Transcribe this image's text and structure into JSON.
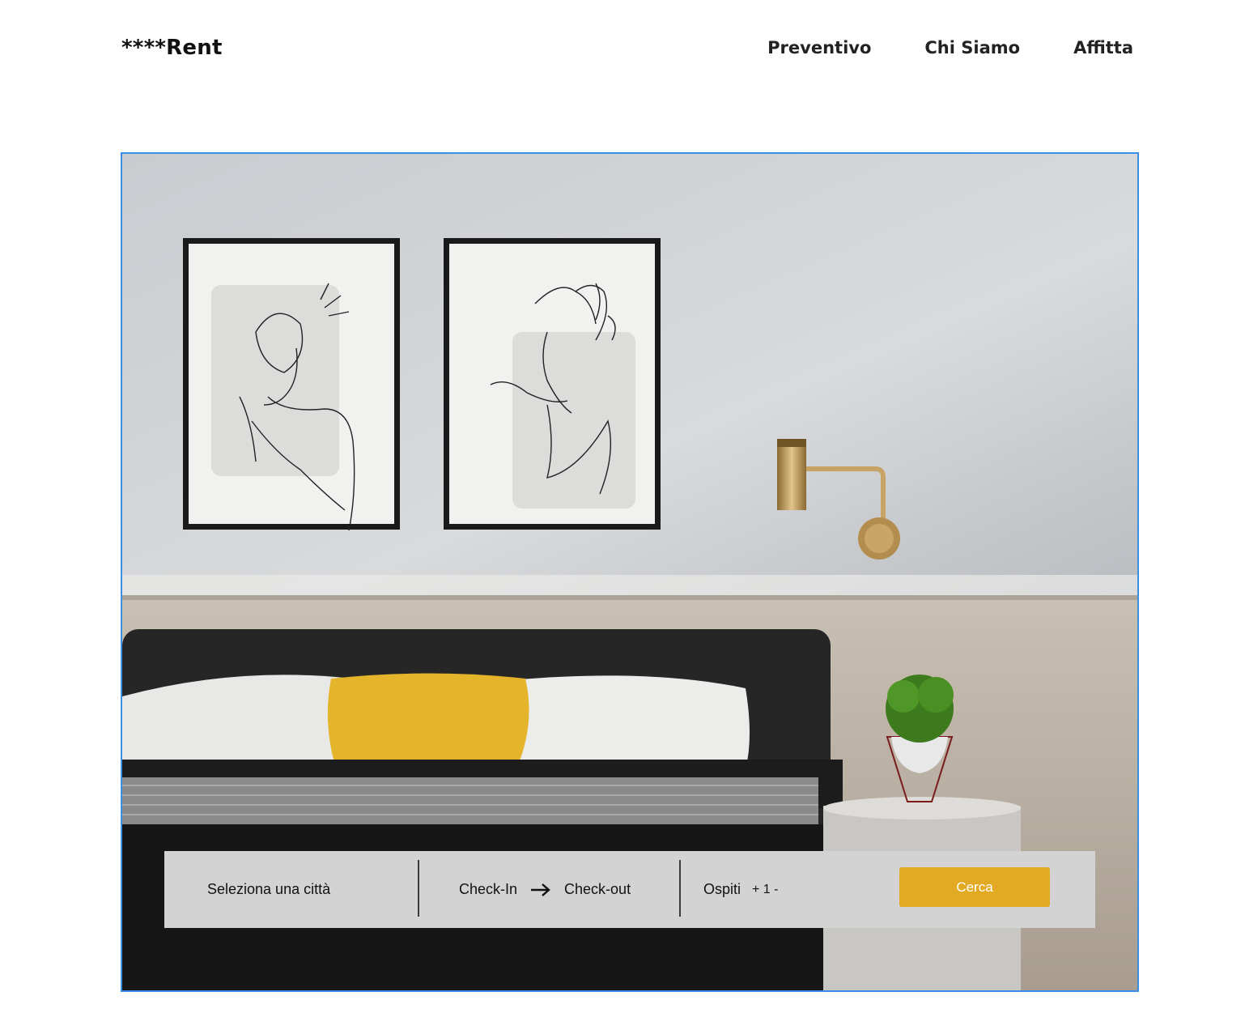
{
  "header": {
    "logo": "****Rent",
    "nav": [
      "Preventivo",
      "Chi Siamo",
      "Affitta"
    ]
  },
  "search": {
    "city_placeholder": "Seleziona una città",
    "checkin": "Check-In",
    "checkout": "Check-out",
    "guests_label": "Ospiti",
    "guests_controls": "+ 1 -",
    "submit_label": "Cerca"
  },
  "colors": {
    "accent": "#e2a922",
    "hero_border": "#3a8ee6",
    "search_bg": "#d3d3d3"
  }
}
